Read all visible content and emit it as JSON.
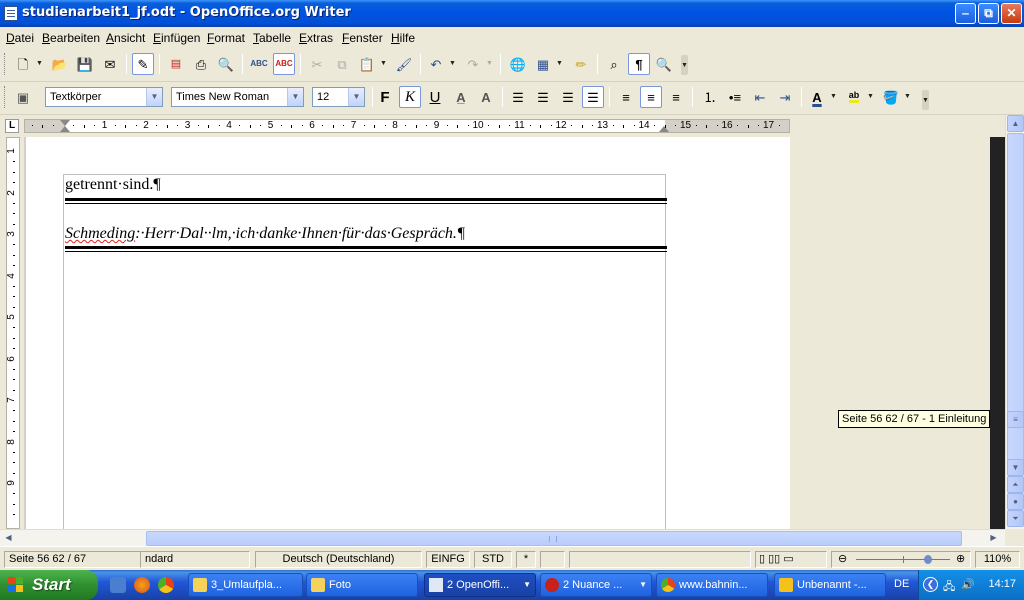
{
  "window": {
    "title": "studienarbeit1_jf.odt - OpenOffice.org Writer",
    "minimize_glyph": "‒",
    "maximize_glyph": "⧉",
    "close_glyph": "✕"
  },
  "menu": [
    "Datei",
    "Bearbeiten",
    "Ansicht",
    "Einfügen",
    "Format",
    "Tabelle",
    "Extras",
    "Fenster",
    "Hilfe"
  ],
  "formatting": {
    "paragraph_style": "Textkörper",
    "font_name": "Times New Roman",
    "font_size": "12",
    "bold_label": "F",
    "italic_label": "K",
    "underline_label": "U"
  },
  "ruler": {
    "h_numbers": [
      "1",
      "2",
      "3",
      "4",
      "5",
      "6",
      "7",
      "8",
      "9",
      "10",
      "11",
      "12",
      "13",
      "14",
      "15",
      "16",
      "17"
    ],
    "v_numbers": [
      "1",
      "2",
      "3",
      "4",
      "5",
      "6",
      "7",
      "8",
      "9"
    ],
    "tab_label": "L"
  },
  "document": {
    "line1": "getrennt·sind.¶",
    "line2_speaker": "Schmeding",
    "line2_rest": ":·Herr·Dal··lm,·ich·danke·Ihnen·für·das·Gespräch.¶"
  },
  "tooltip": "Seite 56   62 / 67  -  1 Einleitung",
  "status": {
    "page": "Seite 56   62 / 67",
    "style": "ndard",
    "language": "Deutsch (Deutschland)",
    "insert_mode": "EINFG",
    "selection_mode": "STD",
    "modified": "*",
    "zoom": "110%"
  },
  "zoom_level": 0.4,
  "taskbar": {
    "start": "Start",
    "tasks": [
      {
        "label": "3_Umlaufpla...",
        "icon": "folder-icon"
      },
      {
        "label": "Foto",
        "icon": "folder-icon"
      },
      {
        "label": "2 OpenOffi...",
        "icon": "openoffice-icon"
      },
      {
        "label": "2 Nuance ...",
        "icon": "nuance-icon"
      },
      {
        "label": "www.bahnin...",
        "icon": "chrome-icon"
      },
      {
        "label": "Unbenannt -...",
        "icon": "paint-icon"
      }
    ],
    "language": "DE",
    "clock": "14:17"
  },
  "colors": {
    "title_blue": "#0054e3",
    "spell_error": "#e02020",
    "start_green": "#2f8f2f"
  }
}
